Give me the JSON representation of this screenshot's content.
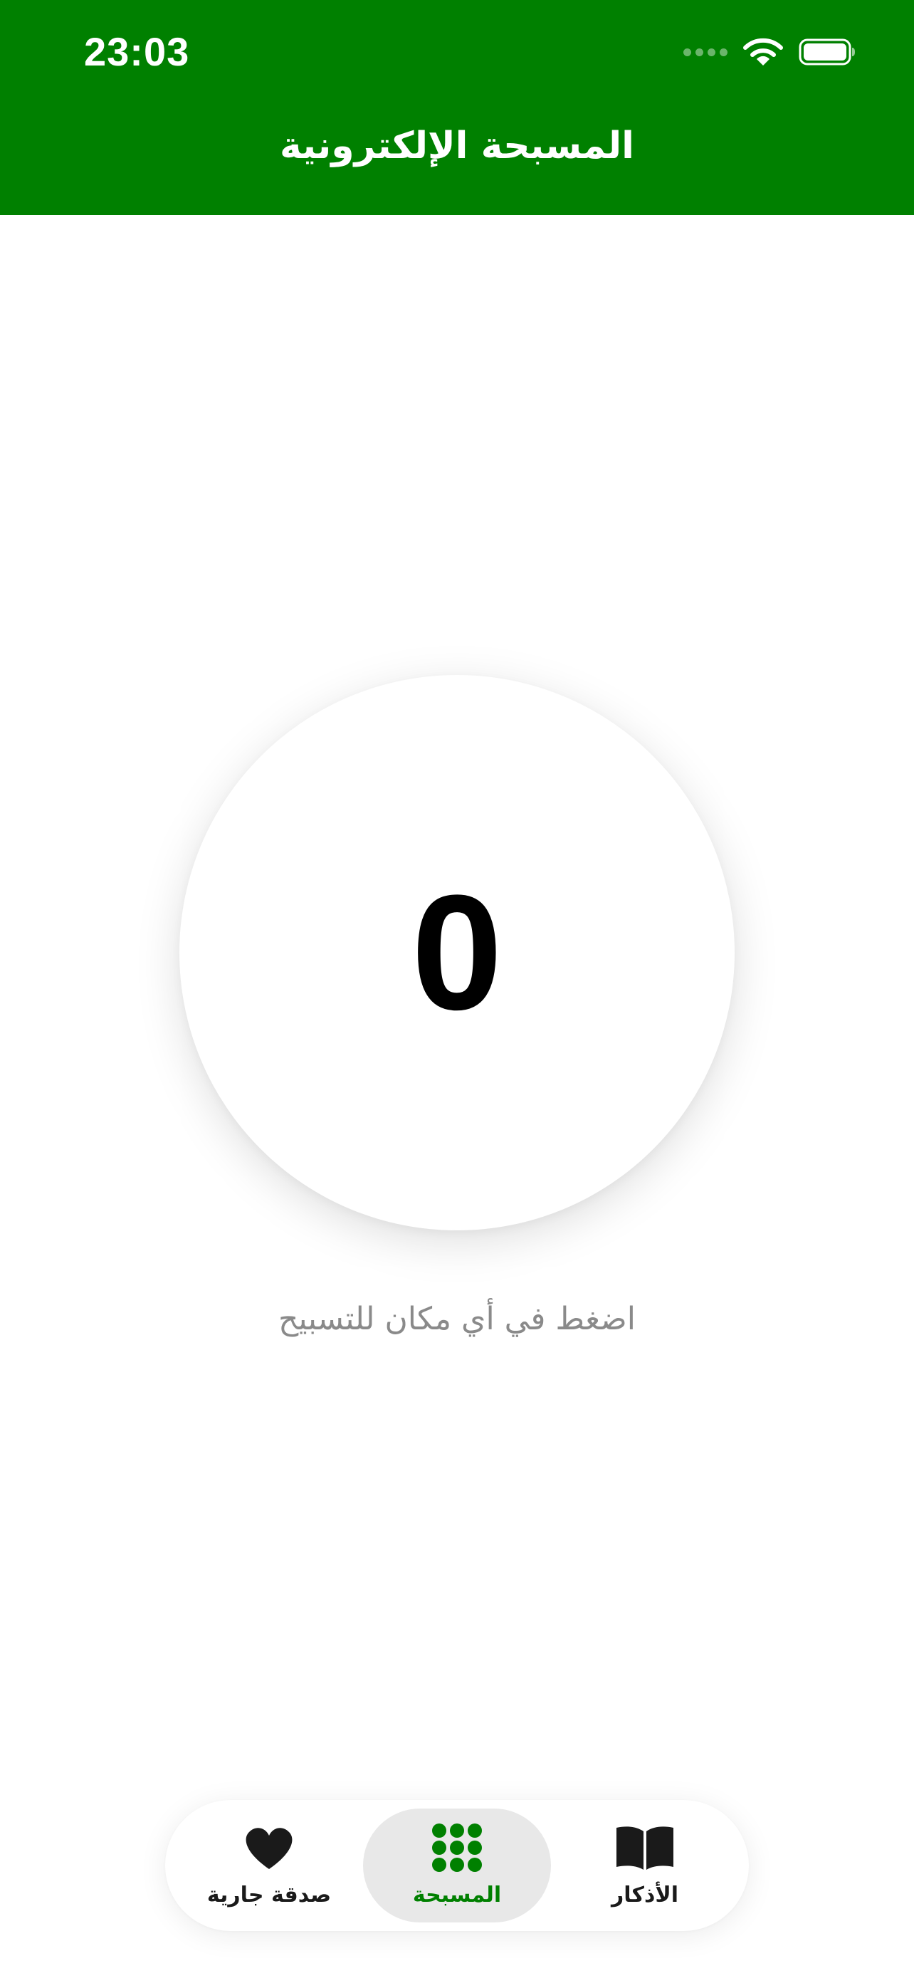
{
  "status_bar": {
    "time": "23:03"
  },
  "header": {
    "title": "المسبحة الإلكترونية"
  },
  "counter": {
    "value": "0",
    "hint": "اضغط في أي مكان للتسبيح"
  },
  "tab_bar": {
    "active_tab": "tasbih",
    "tabs": [
      {
        "id": "sadaqa",
        "label": "صدقة جارية",
        "icon": "heart-icon"
      },
      {
        "id": "tasbih",
        "label": "المسبحة",
        "icon": "beads-grid-icon"
      },
      {
        "id": "adhkar",
        "label": "الأذكار",
        "icon": "open-book-icon"
      }
    ]
  },
  "colors": {
    "brand_green": "#008000",
    "active_tab_background": "#e8e8e8",
    "hint_text": "#8a8a8a"
  }
}
